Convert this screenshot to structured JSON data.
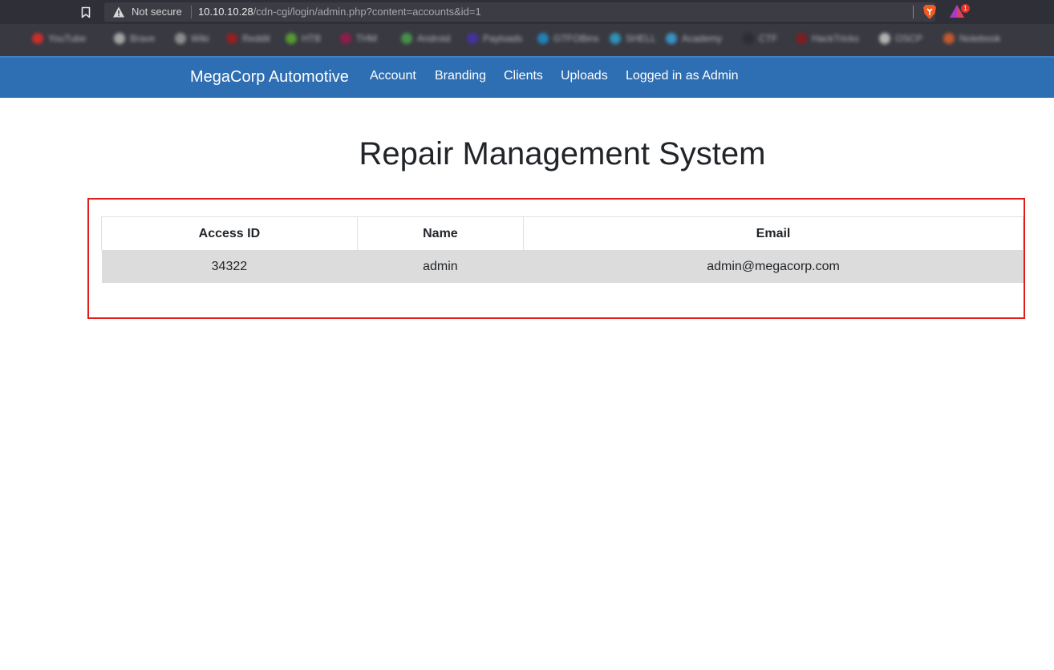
{
  "browser": {
    "security_label": "Not secure",
    "url_host": "10.10.10.28",
    "url_path": "/cdn-cgi/login/admin.php?content=accounts&id=1",
    "rewards_badge": "1",
    "bookmarks": [
      {
        "label": "YouTube",
        "color": "#e52d27"
      },
      {
        "label": "Brave",
        "color": "#b8b8b8"
      },
      {
        "label": "Wiki",
        "color": "#9c9c9c"
      },
      {
        "label": "Reddit",
        "color": "#a11d1d"
      },
      {
        "label": "HTB",
        "color": "#5fa830"
      },
      {
        "label": "THM",
        "color": "#a0184a"
      },
      {
        "label": "Android",
        "color": "#4aa04a"
      },
      {
        "label": "Payloads",
        "color": "#4a2fb0"
      },
      {
        "label": "GTFOBins",
        "color": "#1f8fc8"
      },
      {
        "label": "SHELL",
        "color": "#2fa0c8"
      },
      {
        "label": "Academy",
        "color": "#3aa0d8"
      },
      {
        "label": "CTF",
        "color": "#2b2b30"
      },
      {
        "label": "HackTricks",
        "color": "#8a1a1a"
      },
      {
        "label": "OSCP",
        "color": "#c8c8c8"
      },
      {
        "label": "Notebook",
        "color": "#d8602a"
      }
    ]
  },
  "navbar": {
    "brand": "MegaCorp Automotive",
    "links": [
      "Account",
      "Branding",
      "Clients",
      "Uploads",
      "Logged in as Admin"
    ]
  },
  "main": {
    "title": "Repair Management System",
    "table": {
      "headers": [
        "Access ID",
        "Name",
        "Email"
      ],
      "rows": [
        [
          "34322",
          "admin",
          "admin@megacorp.com"
        ]
      ]
    }
  },
  "colors": {
    "navbar": "#2e6eb2",
    "highlight_border": "#e31b1b",
    "row_background": "#dcdcdc"
  }
}
